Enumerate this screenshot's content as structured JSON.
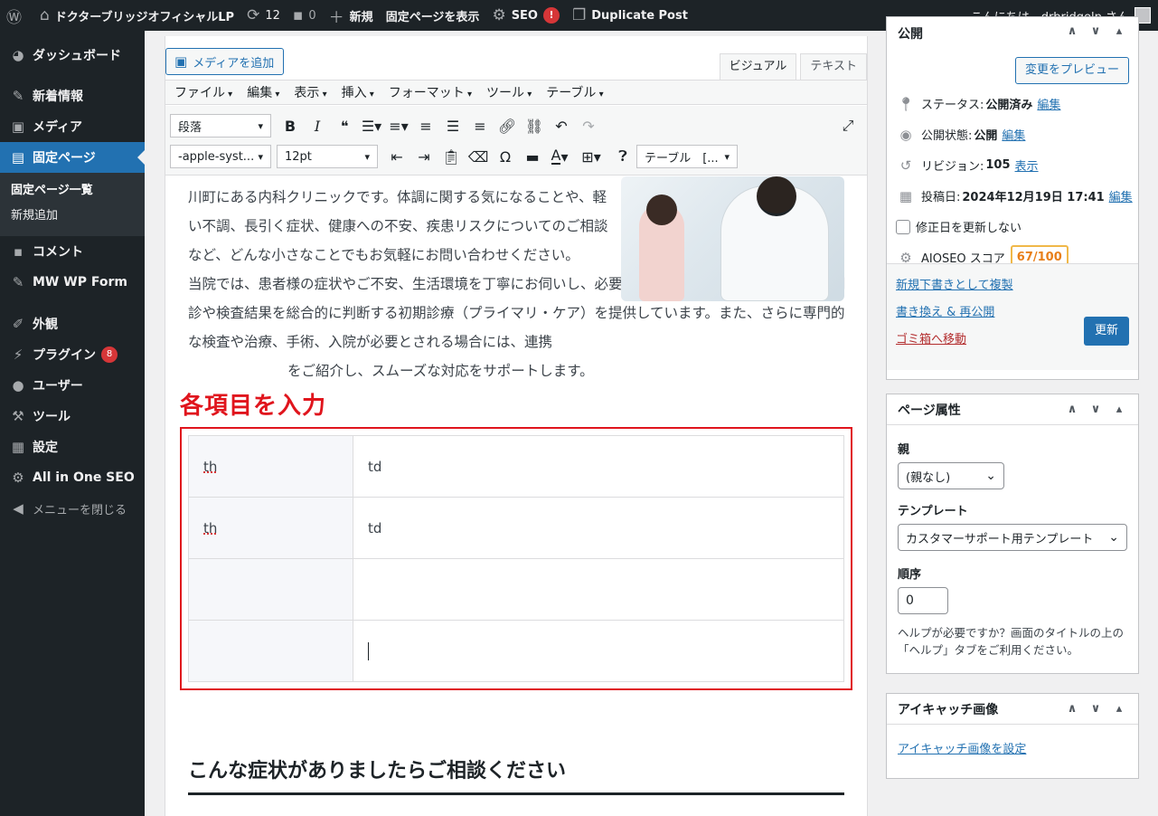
{
  "adminbar": {
    "site_name": "ドクターブリッジオフィシャルLP",
    "updates_count": "12",
    "comments_count": "0",
    "new_label": "新規",
    "view_page": "固定ページを表示",
    "seo_label": "SEO",
    "seo_badge": "!",
    "duplicate_label": "Duplicate Post",
    "greeting": "こんにちは、drbridgelp さん"
  },
  "sidebar": {
    "items": [
      {
        "label": "ダッシュボード",
        "icon": "dashboard-icon"
      },
      {
        "label": "新着情報",
        "icon": "pin-icon"
      },
      {
        "label": "メディア",
        "icon": "media-icon"
      },
      {
        "label": "固定ページ",
        "icon": "page-icon"
      },
      {
        "label": "固定ページ一覧"
      },
      {
        "label": "新規追加"
      },
      {
        "label": "コメント",
        "icon": "comment-icon"
      },
      {
        "label": "MW WP Form",
        "icon": "pin-icon"
      },
      {
        "label": "外観",
        "icon": "brush-icon"
      },
      {
        "label": "プラグイン",
        "icon": "plugin-icon",
        "badge": "8"
      },
      {
        "label": "ユーザー",
        "icon": "user-icon"
      },
      {
        "label": "ツール",
        "icon": "wrench-icon"
      },
      {
        "label": "設定",
        "icon": "settings-icon"
      },
      {
        "label": "All in One SEO",
        "icon": "gear-icon"
      },
      {
        "label": "メニューを閉じる",
        "icon": "collapse-icon"
      }
    ]
  },
  "editor": {
    "add_media": "メディアを追加",
    "tab_visual": "ビジュアル",
    "tab_text": "テキスト",
    "menus": [
      "ファイル",
      "編集",
      "表示",
      "挿入",
      "フォーマット",
      "ツール",
      "テーブル"
    ],
    "format_select": "段落",
    "font_select": "-apple-syst...",
    "size_select": "12pt",
    "table_select": "テーブル　[..."
  },
  "content": {
    "para1": "川町にある内科クリニックです。体調に関する気になることや、軽い不調、長引く症状、健康への不安、疾患リスクについてのご相談など、どんな小さなことでもお気軽にお問い合わせください。",
    "para2": "当院では、患者様の症状やご不安、生活環境を丁寧にお伺いし、必要に応じた検査を実施したうえで、問診や検査結果を総合的に判断する初期診療（プライマリ・ケア）を提供しています。また、さらに専門的な検査や治療、手術、入院が必要とされる場合には、連携",
    "para3": "をご紹介し、スムーズな対応をサポートします。",
    "annotation": "各項目を入力",
    "table": [
      {
        "th": "th",
        "td": "td"
      },
      {
        "th": "th",
        "td": "td"
      },
      {
        "th": "",
        "td": ""
      },
      {
        "th": "",
        "td": ""
      }
    ],
    "heading": "こんな症状がありましたらご相談ください"
  },
  "publish": {
    "title": "公開",
    "preview_btn": "変更をプレビュー",
    "status_label": "ステータス:",
    "status_value": "公開済み",
    "visibility_label": "公開状態:",
    "visibility_value": "公開",
    "revision_label": "リビジョン:",
    "revision_value": "105",
    "revision_link": "表示",
    "date_label": "投稿日:",
    "date_value": "2024年12月19日 17:41",
    "edit_link": "編集",
    "no_update_date": "修正日を更新しない",
    "aioseo_label": "AIOSEO スコア",
    "aioseo_score": "67/100",
    "copy_draft": "新規下書きとして複製",
    "rewrite": "書き換え & 再公開",
    "trash": "ゴミ箱へ移動",
    "update_btn": "更新"
  },
  "attributes": {
    "title": "ページ属性",
    "parent_label": "親",
    "parent_value": "(親なし)",
    "template_label": "テンプレート",
    "template_value": "カスタマーサポート用テンプレート",
    "order_label": "順序",
    "order_value": "0",
    "help_text": "ヘルプが必要ですか？画面のタイトルの上の「ヘルプ」タブをご利用ください。"
  },
  "featured": {
    "title": "アイキャッチ画像",
    "set_link": "アイキャッチ画像を設定"
  }
}
